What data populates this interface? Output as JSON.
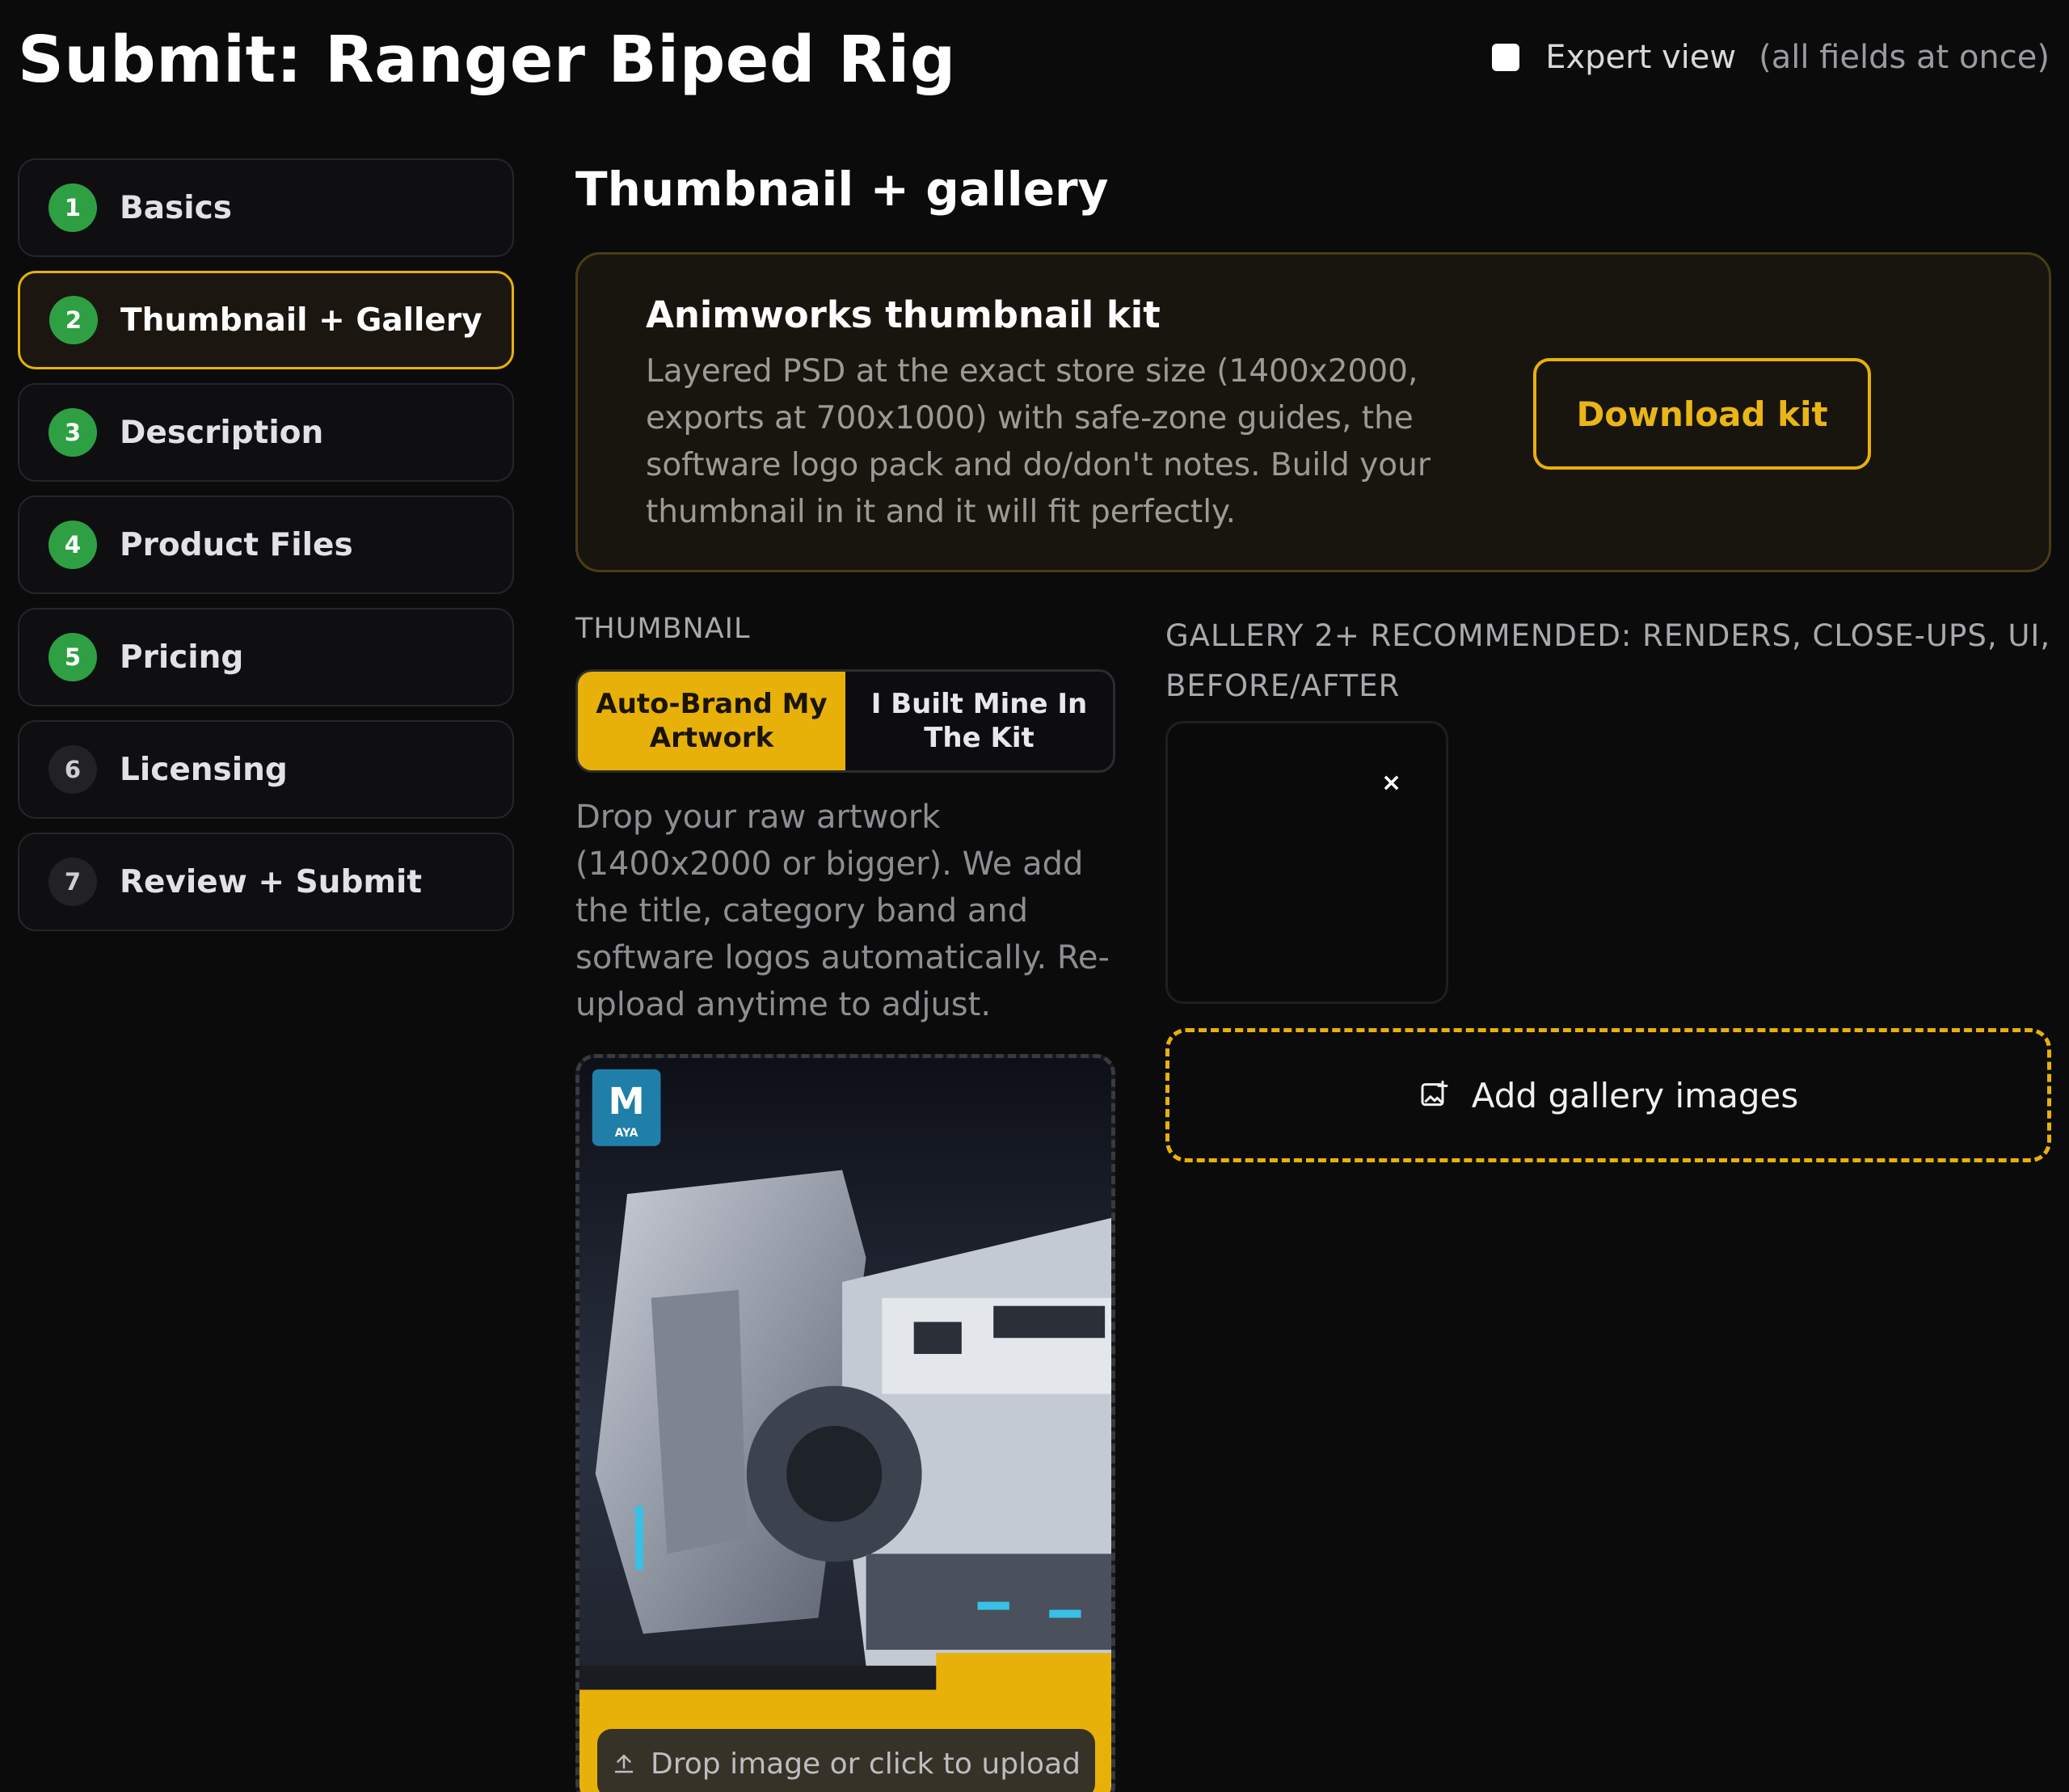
{
  "header": {
    "title": "Submit: Ranger Biped Rig",
    "expert_label": "Expert view",
    "expert_hint": "(all fields at once)",
    "expert_checked": false
  },
  "steps": [
    {
      "number": "1",
      "label": "Basics",
      "status": "complete"
    },
    {
      "number": "2",
      "label": "Thumbnail + Gallery",
      "status": "current"
    },
    {
      "number": "3",
      "label": "Description",
      "status": "complete"
    },
    {
      "number": "4",
      "label": "Product Files",
      "status": "complete"
    },
    {
      "number": "5",
      "label": "Pricing",
      "status": "complete"
    },
    {
      "number": "6",
      "label": "Licensing",
      "status": "pending"
    },
    {
      "number": "7",
      "label": "Review + Submit",
      "status": "pending"
    }
  ],
  "main": {
    "section_title": "Thumbnail + gallery",
    "kit": {
      "title": "Animworks thumbnail kit",
      "body": "Layered PSD at the exact store size (1400x2000, exports at 700x1000) with safe-zone guides, the software logo pack and do/don't notes. Build your thumbnail in it and it will fit perfectly.",
      "button": "Download kit"
    },
    "thumbnail": {
      "label": "THUMBNAIL",
      "options": [
        "Auto-Brand My Artwork",
        "I Built Mine In The Kit"
      ],
      "selected": "Auto-Brand My Artwork",
      "description": "Drop your raw artwork (1400x2000 or bigger). We add the title, category band and software logos automatically. Re-upload anytime to adjust.",
      "upload_text": "Drop image or click to upload"
    },
    "gallery": {
      "label": "GALLERY 2+ RECOMMENDED: RENDERS, CLOSE-UPS, UI, BEFORE/AFTER",
      "remove_symbol": "×",
      "add_text": "Add gallery images"
    }
  },
  "colors": {
    "accent": "#e7b10a",
    "complete": "#2ea043",
    "background": "#0b0b0c"
  }
}
